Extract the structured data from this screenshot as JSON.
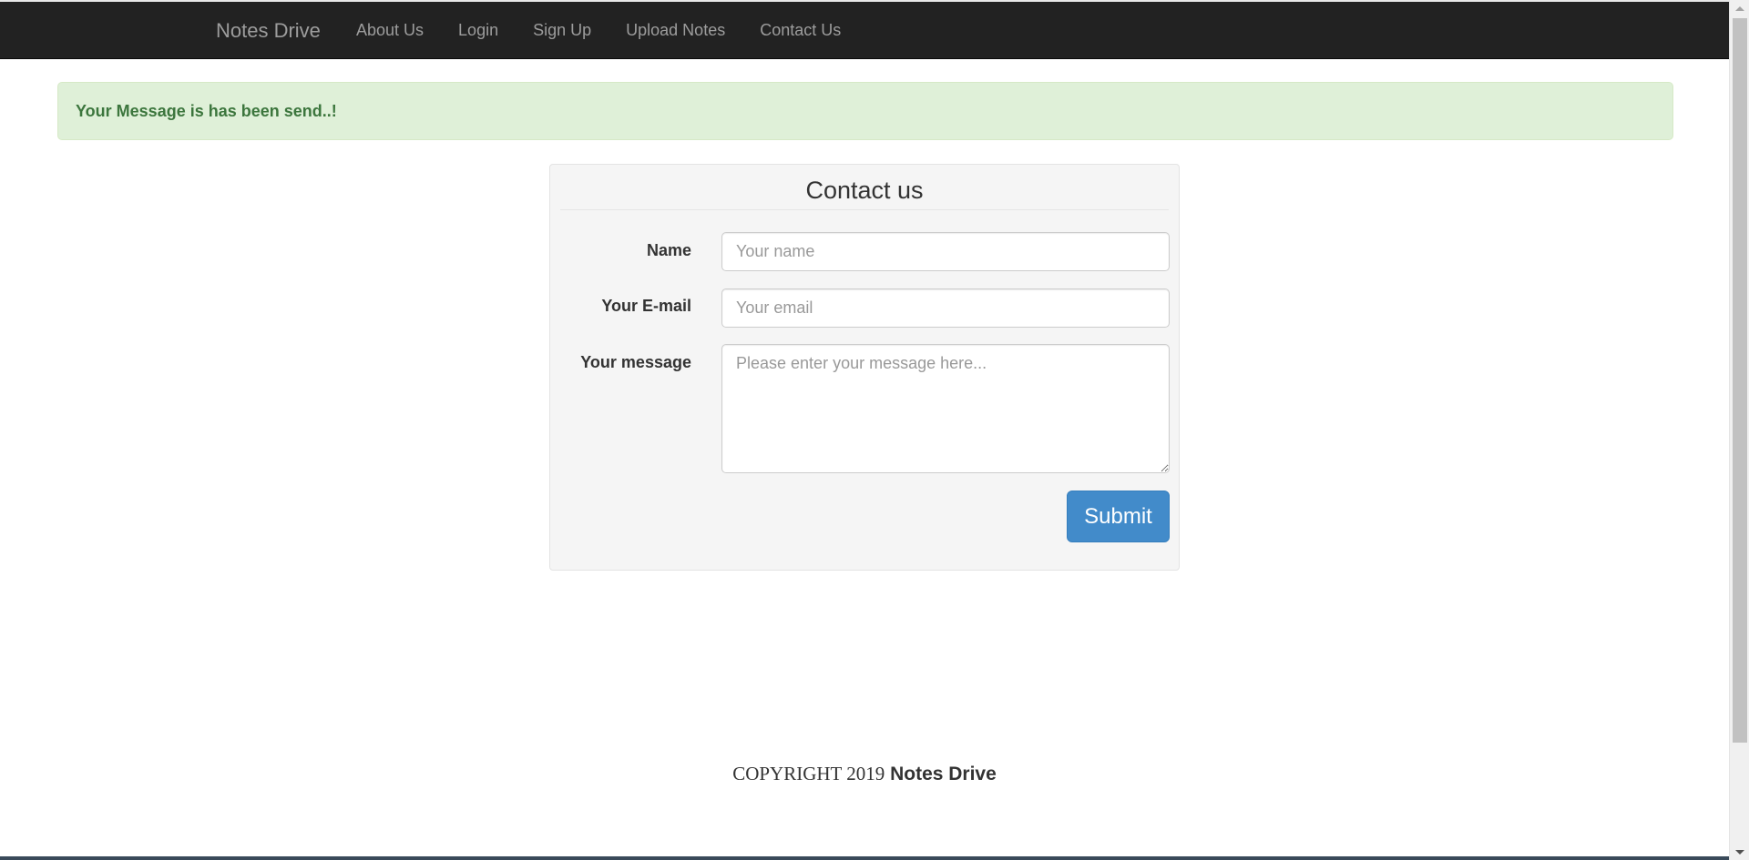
{
  "navbar": {
    "brand": "Notes Drive",
    "items": [
      {
        "label": "About Us"
      },
      {
        "label": "Login"
      },
      {
        "label": "Sign Up"
      },
      {
        "label": "Upload Notes"
      },
      {
        "label": "Contact Us"
      }
    ],
    "background_color": "#222222",
    "link_color": "#9d9d9d"
  },
  "alert": {
    "message": "Your Message is has been send..!",
    "background_color": "#dff0d8",
    "text_color": "#3c763d"
  },
  "contact_form": {
    "title": "Contact us",
    "name_label": "Name",
    "name_placeholder": "Your name",
    "email_label": "Your E-mail",
    "email_placeholder": "Your email",
    "message_label": "Your message",
    "message_placeholder": "Please enter your message here...",
    "submit_label": "Submit",
    "submit_color": "#428bca"
  },
  "footer": {
    "copyright": "COPYRIGHT 2019",
    "brand": "Notes Drive"
  },
  "icons": {
    "scroll_up": "chevron-up-icon",
    "scroll_down": "chevron-down-icon"
  }
}
